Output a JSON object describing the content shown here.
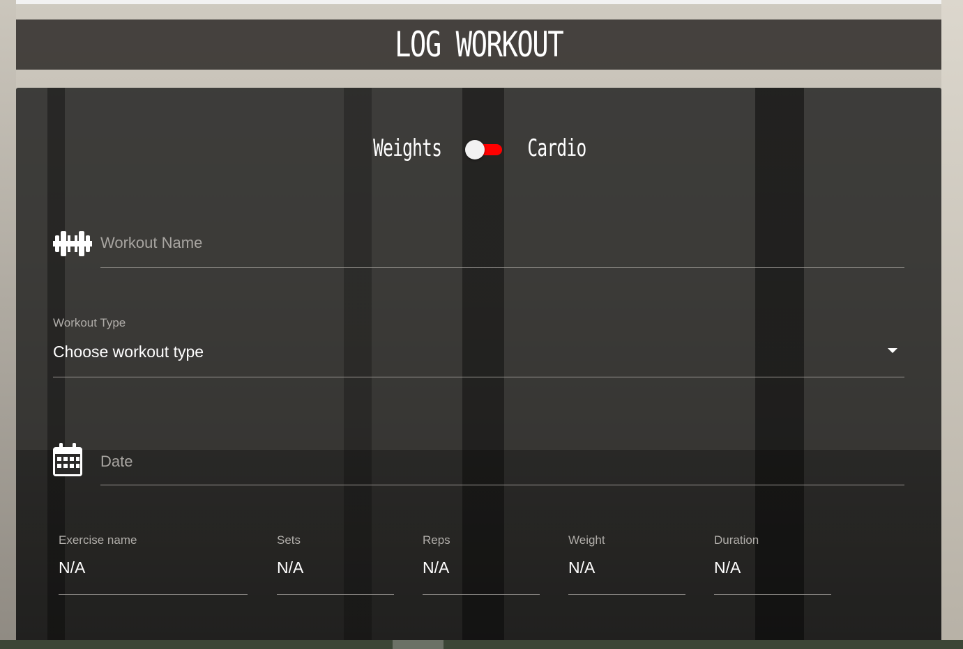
{
  "header": {
    "title": "LOG WORKOUT"
  },
  "toggle": {
    "left_label": "Weights",
    "right_label": "Cardio",
    "state": "cardio",
    "active_color": "#ff0000"
  },
  "form": {
    "workout_name": {
      "placeholder": "Workout Name",
      "value": "",
      "icon": "dumbbell-icon"
    },
    "workout_type": {
      "label": "Workout Type",
      "selected": "Choose workout type"
    },
    "date": {
      "placeholder": "Date",
      "value": "",
      "icon": "calendar-icon"
    },
    "exercise": {
      "name": {
        "label": "Exercise name",
        "value": "N/A"
      },
      "sets": {
        "label": "Sets",
        "value": "N/A"
      },
      "reps": {
        "label": "Reps",
        "value": "N/A"
      },
      "weight": {
        "label": "Weight",
        "value": "N/A"
      },
      "duration": {
        "label": "Duration",
        "value": "N/A"
      }
    }
  }
}
